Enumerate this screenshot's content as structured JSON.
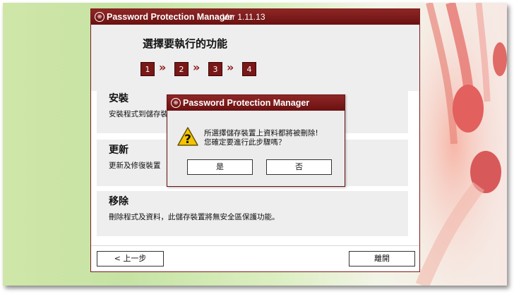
{
  "app": {
    "title": "Password Protection Manager",
    "version": "Ver 1.11.13"
  },
  "header": {
    "heading": "選擇要執行的功能",
    "steps": [
      "1",
      "2",
      "3",
      "4"
    ],
    "step_separator": "»"
  },
  "sections": [
    {
      "title": "安裝",
      "desc": "安裝程式到儲存裝"
    },
    {
      "title": "更新",
      "desc": "更新及修復裝置"
    },
    {
      "title": "移除",
      "desc": "刪除程式及資料，此儲存裝置將無安全區保護功能。"
    }
  ],
  "footer": {
    "back_label": "< 上一步",
    "exit_label": "離開"
  },
  "dialog": {
    "title": "Password Protection Manager",
    "line1": "所選擇儲存裝置上資料都將被刪除!",
    "line2": "您確定要進行此步驟嗎？",
    "yes_label": "是",
    "no_label": "否"
  },
  "colors": {
    "titlebar": "#7a1717",
    "accent": "#8a1a1a",
    "panel": "#eeeeee"
  }
}
